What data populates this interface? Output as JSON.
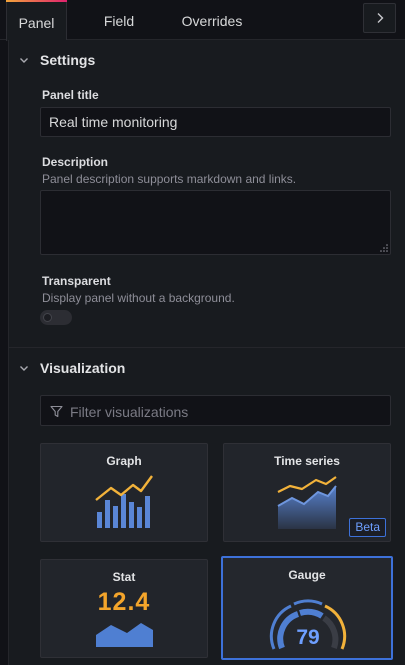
{
  "tabs": {
    "panel": "Panel",
    "field": "Field",
    "overrides": "Overrides"
  },
  "settings": {
    "title": "Settings",
    "panel_title_label": "Panel title",
    "panel_title_value": "Real time monitoring",
    "description_label": "Description",
    "description_help": "Panel description supports markdown and links.",
    "description_value": "",
    "transparent_label": "Transparent",
    "transparent_help": "Display panel without a background.",
    "transparent_on": false
  },
  "visualization": {
    "title": "Visualization",
    "filter_placeholder": "Filter visualizations",
    "cards": {
      "graph": "Graph",
      "time_series": "Time series",
      "time_series_badge": "Beta",
      "stat": "Stat",
      "stat_value": "12.4",
      "gauge": "Gauge",
      "gauge_value": "79"
    },
    "selected": "Gauge"
  },
  "colors": {
    "accent_blue": "#3d71d9",
    "graph_yellow": "#f2b23a",
    "graph_blue": "#5a86d6",
    "tab_gradient_start": "#f2a43a",
    "tab_gradient_end": "#e0226e"
  }
}
